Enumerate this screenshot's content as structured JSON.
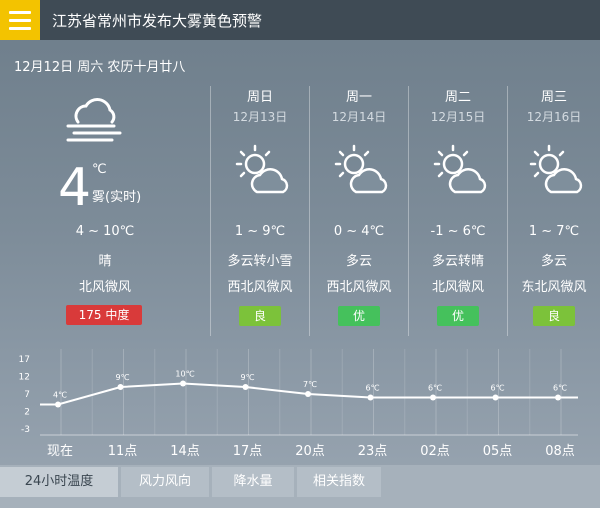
{
  "header": {
    "alert_title": "江苏省常州市发布大雾黄色预警"
  },
  "date_line": "12月12日 周六 农历十月廿八",
  "today": {
    "temp": "4",
    "unit": "℃",
    "condition": "雾(实时)",
    "range": "4 ~ 10℃",
    "weather": "晴",
    "wind": "北风微风",
    "aqi": "175  中度",
    "aqi_color": "#d93a3a"
  },
  "forecast": [
    {
      "day": "周日",
      "date": "12月13日",
      "range": "1 ~ 9℃",
      "weather": "多云转小雪",
      "wind": "西北风微风",
      "aqi": "良",
      "aqi_color": "#7cc23a"
    },
    {
      "day": "周一",
      "date": "12月14日",
      "range": "0 ~ 4℃",
      "weather": "多云",
      "wind": "西北风微风",
      "aqi": "优",
      "aqi_color": "#45c15c"
    },
    {
      "day": "周二",
      "date": "12月15日",
      "range": "-1 ~ 6℃",
      "weather": "多云转晴",
      "wind": "北风微风",
      "aqi": "优",
      "aqi_color": "#45c15c"
    },
    {
      "day": "周三",
      "date": "12月16日",
      "range": "1 ~ 7℃",
      "weather": "多云",
      "wind": "东北风微风",
      "aqi": "良",
      "aqi_color": "#7cc23a"
    }
  ],
  "chart_data": {
    "type": "line",
    "categories": [
      "现在",
      "11点",
      "14点",
      "17点",
      "20点",
      "23点",
      "02点",
      "05点",
      "08点"
    ],
    "values": [
      4,
      9,
      10,
      9,
      7,
      6,
      6,
      6,
      6
    ],
    "point_labels": [
      "4℃",
      "9℃",
      "10℃",
      "9℃",
      "7℃",
      "6℃",
      "6℃",
      "6℃",
      "6℃"
    ],
    "y_ticks": [
      "17",
      "12",
      "7",
      "2",
      "-3"
    ],
    "ylim": [
      -3,
      17
    ],
    "grid": "vertical"
  },
  "tabs": [
    {
      "label": "24小时温度",
      "active": true
    },
    {
      "label": "风力风向",
      "active": false
    },
    {
      "label": "降水量",
      "active": false
    },
    {
      "label": "相关指数",
      "active": false
    }
  ]
}
